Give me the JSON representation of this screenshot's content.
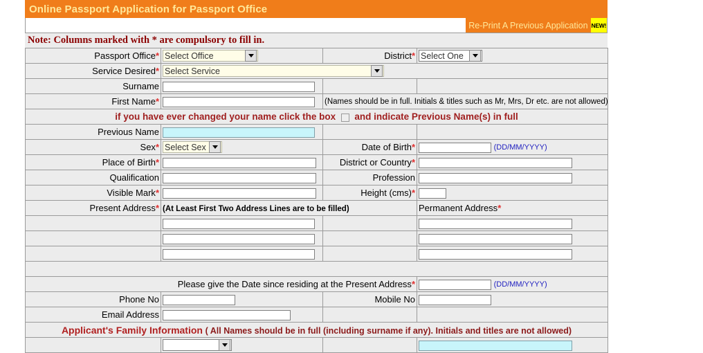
{
  "header": {
    "title": "Online Passport Application for Passport Office",
    "bg_color": "#f07d1a",
    "text_color": "#ffe89a"
  },
  "reprint": {
    "label": "Re-Print A Previous Application",
    "badge": "NEW!",
    "badge_color": "#ffff00"
  },
  "note": {
    "text": "Note: Columns marked with * are compulsory to fill in.",
    "color": "#8b0000"
  },
  "form": {
    "passport_office": {
      "label": "Passport Office",
      "required": "*",
      "value": "Select Office"
    },
    "district": {
      "label": "District",
      "required": "*",
      "value": "Select One"
    },
    "service_desired": {
      "label": "Service Desired",
      "required": "*",
      "value": "Select Service"
    },
    "surname": {
      "label": "Surname",
      "value": ""
    },
    "first_name": {
      "label": "First Name",
      "required": "*",
      "value": "",
      "hint": "(Names should be in full. Initials & titles such as Mr, Mrs, Dr etc. are not allowed)"
    },
    "name_change_banner": {
      "text_before": "if you have ever changed your name click the box",
      "text_after": "and indicate Previous Name(s) in full"
    },
    "previous_name": {
      "label": "Previous Name",
      "value": ""
    },
    "sex": {
      "label": "Sex",
      "required": "*",
      "value": "Select Sex"
    },
    "date_of_birth": {
      "label": "Date of Birth",
      "required": "*",
      "value": "",
      "hint": "(DD/MM/YYYY)"
    },
    "place_of_birth": {
      "label": "Place of Birth",
      "required": "*",
      "value": ""
    },
    "district_or_country": {
      "label": "District or Country",
      "required": "*",
      "value": ""
    },
    "qualification": {
      "label": "Qualification",
      "value": ""
    },
    "profession": {
      "label": "Profession",
      "value": ""
    },
    "visible_mark": {
      "label": "Visible Mark",
      "required": "*",
      "value": ""
    },
    "height_cms": {
      "label": "Height (cms)",
      "required": "*",
      "value": ""
    },
    "present_address": {
      "label": "Present Address",
      "required": "*",
      "hint": "(At Least First Two Address Lines are to be filled)",
      "line1": "",
      "line2": "",
      "line3": ""
    },
    "permanent_address": {
      "label": "Permanent Address",
      "required": "*",
      "line1": "",
      "line2": "",
      "line3": ""
    },
    "residing_since": {
      "label": "Please give the Date since residing at the Present Address",
      "required": "*",
      "value": "",
      "hint": "(DD/MM/YYYY)"
    },
    "phone_no": {
      "label": "Phone No",
      "value": ""
    },
    "mobile_no": {
      "label": "Mobile No",
      "value": ""
    },
    "email_address": {
      "label": "Email Address",
      "value": ""
    },
    "family_info": {
      "title": "Applicant's Family Information",
      "subtitle": "( All Names should be in full (including surname if any). Initials and titles are not allowed)"
    }
  }
}
